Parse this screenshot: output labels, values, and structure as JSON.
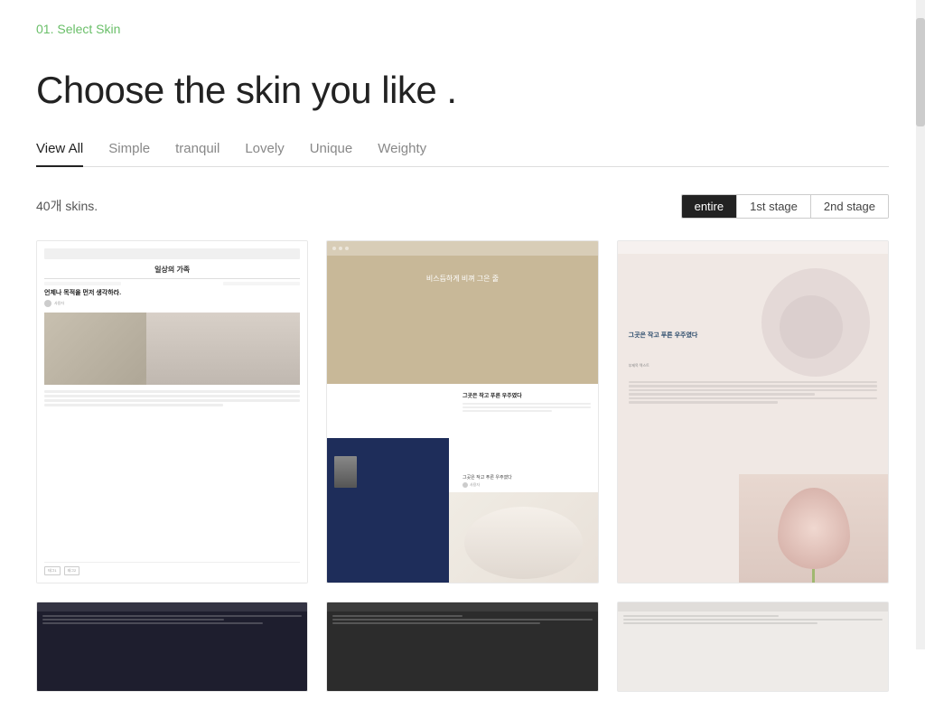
{
  "step": {
    "label": "01. Select Skin"
  },
  "hero": {
    "title": "Choose the skin you like ."
  },
  "tabs": [
    {
      "id": "view-all",
      "label": "View All",
      "active": true
    },
    {
      "id": "simple",
      "label": "Simple",
      "active": false
    },
    {
      "id": "tranquil",
      "label": "tranquil",
      "active": false
    },
    {
      "id": "lovely",
      "label": "Lovely",
      "active": false
    },
    {
      "id": "unique",
      "label": "Unique",
      "active": false
    },
    {
      "id": "weighty",
      "label": "Weighty",
      "active": false
    }
  ],
  "filters": {
    "skin_count": "40개 skins.",
    "stage_buttons": [
      {
        "id": "entire",
        "label": "entire",
        "active": true
      },
      {
        "id": "1st-stage",
        "label": "1st stage",
        "active": false
      },
      {
        "id": "2nd-stage",
        "label": "2nd stage",
        "active": false
      }
    ]
  },
  "skins": [
    {
      "id": 1,
      "theme": "white-minimal"
    },
    {
      "id": 2,
      "theme": "tan-navy"
    },
    {
      "id": 3,
      "theme": "pink-pastel"
    },
    {
      "id": 4,
      "theme": "dark-1"
    },
    {
      "id": 5,
      "theme": "dark-2"
    },
    {
      "id": 6,
      "theme": "light-gray"
    }
  ]
}
